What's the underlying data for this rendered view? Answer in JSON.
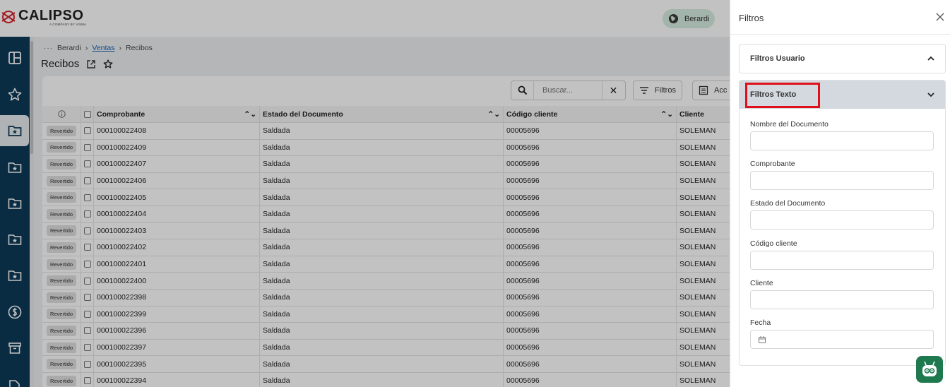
{
  "app": {
    "brand": "CALIPSO",
    "brand_sub": "A COMPANY BY VISMA",
    "user": "Berardi"
  },
  "breadcrumb": {
    "dots": "···",
    "items": [
      "Berardi",
      "Ventas",
      "Recibos"
    ]
  },
  "page": {
    "title": "Recibos"
  },
  "toolbar": {
    "search_placeholder": "Buscar...",
    "filters_label": "Filtros",
    "actions_label": "Acc"
  },
  "grid": {
    "columns": [
      "Comprobante",
      "Estado del Documento",
      "Código cliente",
      "Cliente"
    ],
    "rows": [
      {
        "badge": "Revertido",
        "comprobante": "000100022408",
        "estado": "Saldada",
        "codigo": "00005696",
        "cliente": "SOLEMAN"
      },
      {
        "badge": "Revertido",
        "comprobante": "000100022409",
        "estado": "Saldada",
        "codigo": "00005696",
        "cliente": "SOLEMAN"
      },
      {
        "badge": "Revertido",
        "comprobante": "000100022407",
        "estado": "Saldada",
        "codigo": "00005696",
        "cliente": "SOLEMAN"
      },
      {
        "badge": "Revertido",
        "comprobante": "000100022406",
        "estado": "Saldada",
        "codigo": "00005696",
        "cliente": "SOLEMAN"
      },
      {
        "badge": "Revertido",
        "comprobante": "000100022405",
        "estado": "Saldada",
        "codigo": "00005696",
        "cliente": "SOLEMAN"
      },
      {
        "badge": "Revertido",
        "comprobante": "000100022404",
        "estado": "Saldada",
        "codigo": "00005696",
        "cliente": "SOLEMAN"
      },
      {
        "badge": "Revertido",
        "comprobante": "000100022403",
        "estado": "Saldada",
        "codigo": "00005696",
        "cliente": "SOLEMAN"
      },
      {
        "badge": "Revertido",
        "comprobante": "000100022402",
        "estado": "Saldada",
        "codigo": "00005696",
        "cliente": "SOLEMAN"
      },
      {
        "badge": "Revertido",
        "comprobante": "000100022401",
        "estado": "Saldada",
        "codigo": "00005696",
        "cliente": "SOLEMAN"
      },
      {
        "badge": "Revertido",
        "comprobante": "000100022400",
        "estado": "Saldada",
        "codigo": "00005696",
        "cliente": "SOLEMAN"
      },
      {
        "badge": "Revertido",
        "comprobante": "000100022398",
        "estado": "Saldada",
        "codigo": "00005696",
        "cliente": "SOLEMAN"
      },
      {
        "badge": "Revertido",
        "comprobante": "000100022399",
        "estado": "Saldada",
        "codigo": "00005696",
        "cliente": "SOLEMAN"
      },
      {
        "badge": "Revertido",
        "comprobante": "000100022396",
        "estado": "Saldada",
        "codigo": "00005696",
        "cliente": "SOLEMAN"
      },
      {
        "badge": "Revertido",
        "comprobante": "000100022397",
        "estado": "Saldada",
        "codigo": "00005696",
        "cliente": "SOLEMAN"
      },
      {
        "badge": "Revertido",
        "comprobante": "000100022395",
        "estado": "Saldada",
        "codigo": "00005696",
        "cliente": "SOLEMAN"
      },
      {
        "badge": "Revertido",
        "comprobante": "000100022394",
        "estado": "Saldada",
        "codigo": "00005696",
        "cliente": "SOLEMAN"
      }
    ]
  },
  "panel": {
    "title": "Filtros",
    "section_user": "Filtros Usuario",
    "section_text": "Filtros Texto",
    "fields": [
      "Nombre del Documento",
      "Comprobante",
      "Estado del Documento",
      "Código cliente",
      "Cliente",
      "Fecha"
    ]
  },
  "colors": {
    "sidebar": "#0d3a57",
    "highlight": "#e0101a",
    "bot": "#1e7a4e"
  }
}
